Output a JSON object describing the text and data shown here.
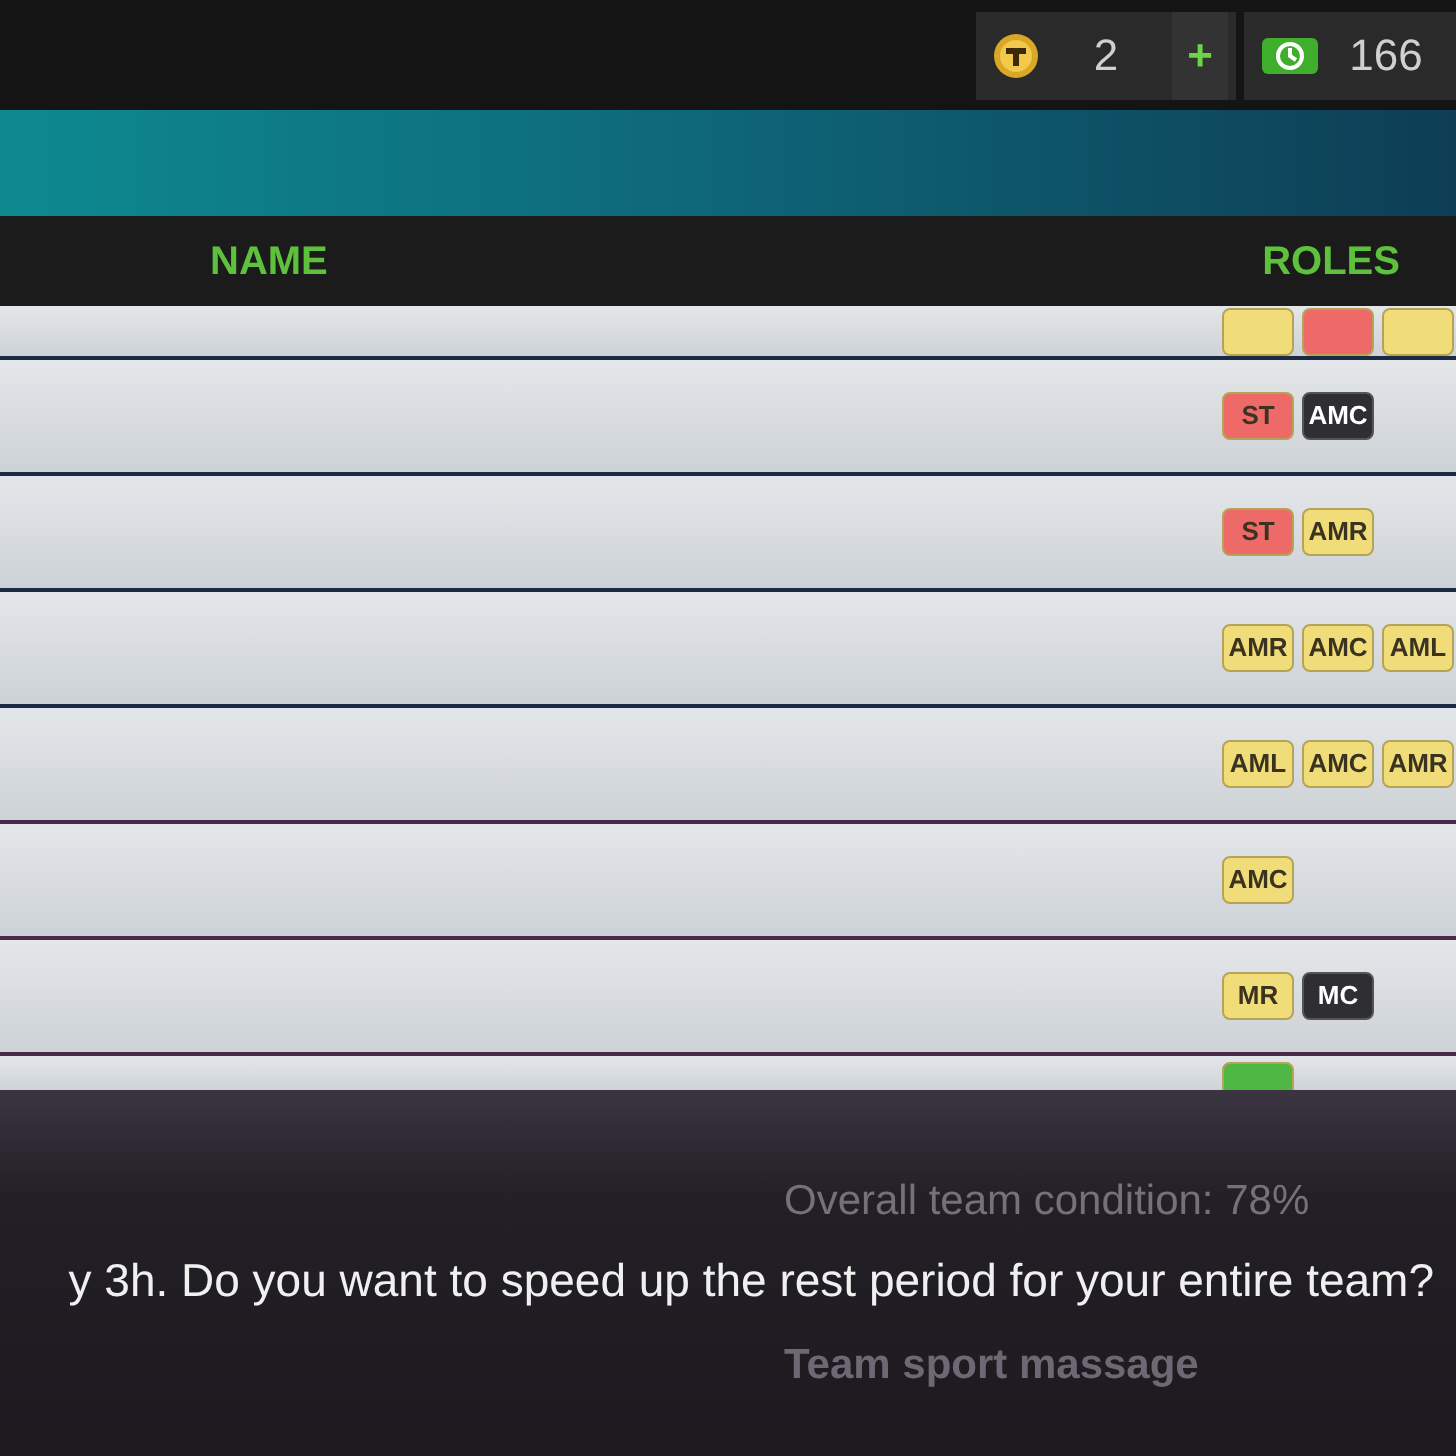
{
  "currencies": [
    {
      "kind": "coin",
      "amount": "2",
      "plus": "+"
    },
    {
      "kind": "cash",
      "amount": "166"
    }
  ],
  "table": {
    "columns": [
      "NAME",
      "ROLES"
    ],
    "rows": [
      {
        "roles": [
          {
            "color": "#f0dc78"
          },
          {
            "color": "#ee6a68"
          },
          {
            "color": "#f0dc78"
          }
        ]
      },
      {
        "roles": [
          {
            "label": "ST",
            "color": "#ee6a68"
          },
          {
            "label": "AMC",
            "color": "#2e2e33"
          }
        ]
      },
      {
        "roles": [
          {
            "label": "ST",
            "color": "#ee6a68"
          },
          {
            "label": "AMR",
            "color": "#f0dc78"
          }
        ]
      },
      {
        "roles": [
          {
            "label": "AMR",
            "color": "#f0dc78"
          },
          {
            "label": "AMC",
            "color": "#f0dc78"
          },
          {
            "label": "AML",
            "color": "#f0dc78"
          }
        ]
      },
      {
        "roles": [
          {
            "label": "AML",
            "color": "#f0dc78"
          },
          {
            "label": "AMC",
            "color": "#f0dc78"
          },
          {
            "label": "AMR",
            "color": "#f0dc78"
          }
        ]
      },
      {
        "roles": [
          {
            "label": "AMC",
            "color": "#f0dc78"
          }
        ]
      },
      {
        "roles": [
          {
            "label": "MR",
            "color": "#f0dc78"
          },
          {
            "label": "MC",
            "color": "#2e2e33"
          }
        ]
      },
      {
        "roles": [
          {
            "color": "#4fb845"
          }
        ]
      }
    ]
  },
  "dialog": {
    "message": "y 3h. Do you want to speed up the rest period for your entire team?",
    "background_lines": [
      "Overall team condition: 78%",
      "Team sport massage"
    ]
  }
}
